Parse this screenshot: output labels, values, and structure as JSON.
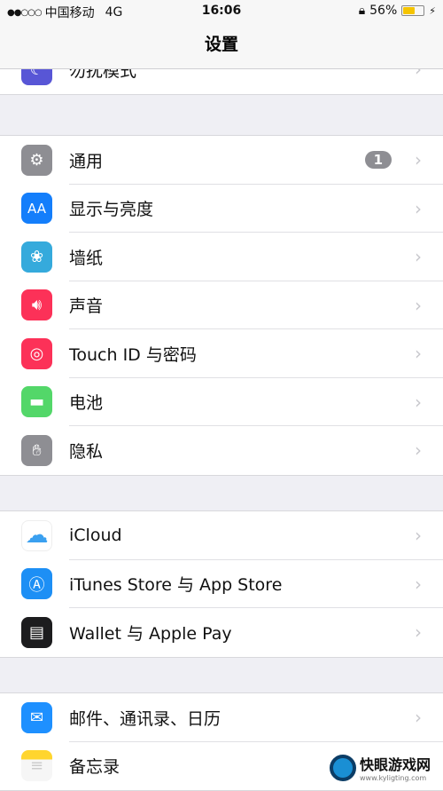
{
  "status_bar": {
    "signal": "●●○○○",
    "carrier": "中国移动",
    "network": "4G",
    "time": "16:06",
    "lock_icon": "orientation-lock-icon",
    "battery_percent": "56%",
    "battery_level": 0.56,
    "charging_icon": "⚡"
  },
  "nav": {
    "title": "设置"
  },
  "groups": [
    {
      "items": [
        {
          "label": "勿扰模式",
          "icon": "moon-icon",
          "color": "#5856d6"
        }
      ]
    },
    {
      "items": [
        {
          "label": "通用",
          "icon": "gear-icon",
          "color": "#8e8e93",
          "badge": "1"
        },
        {
          "label": "显示与亮度",
          "icon": "text-size-icon",
          "color": "#147efb"
        },
        {
          "label": "墙纸",
          "icon": "flower-icon",
          "color": "#35aadc"
        },
        {
          "label": "声音",
          "icon": "speaker-icon",
          "color": "#fc3158"
        },
        {
          "label": "Touch ID 与密码",
          "icon": "fingerprint-icon",
          "color": "#fc3158"
        },
        {
          "label": "电池",
          "icon": "battery-icon",
          "color": "#53d769"
        },
        {
          "label": "隐私",
          "icon": "hand-icon",
          "color": "#8e8e93"
        }
      ]
    },
    {
      "items": [
        {
          "label": "iCloud",
          "icon": "cloud-icon",
          "color": "#ffffff"
        },
        {
          "label": "iTunes Store 与 App Store",
          "icon": "app-store-icon",
          "color": "#1d8ff5"
        },
        {
          "label": "Wallet 与 Apple Pay",
          "icon": "wallet-icon",
          "color": "#1c1c1e"
        }
      ]
    },
    {
      "items": [
        {
          "label": "邮件、通讯录、日历",
          "icon": "mail-icon",
          "color": "#1e90ff"
        },
        {
          "label": "备忘录",
          "icon": "notes-icon",
          "color": "#ffd52e"
        }
      ]
    }
  ],
  "watermark": {
    "name": "快眼游戏网",
    "url": "www.kyligting.com"
  }
}
